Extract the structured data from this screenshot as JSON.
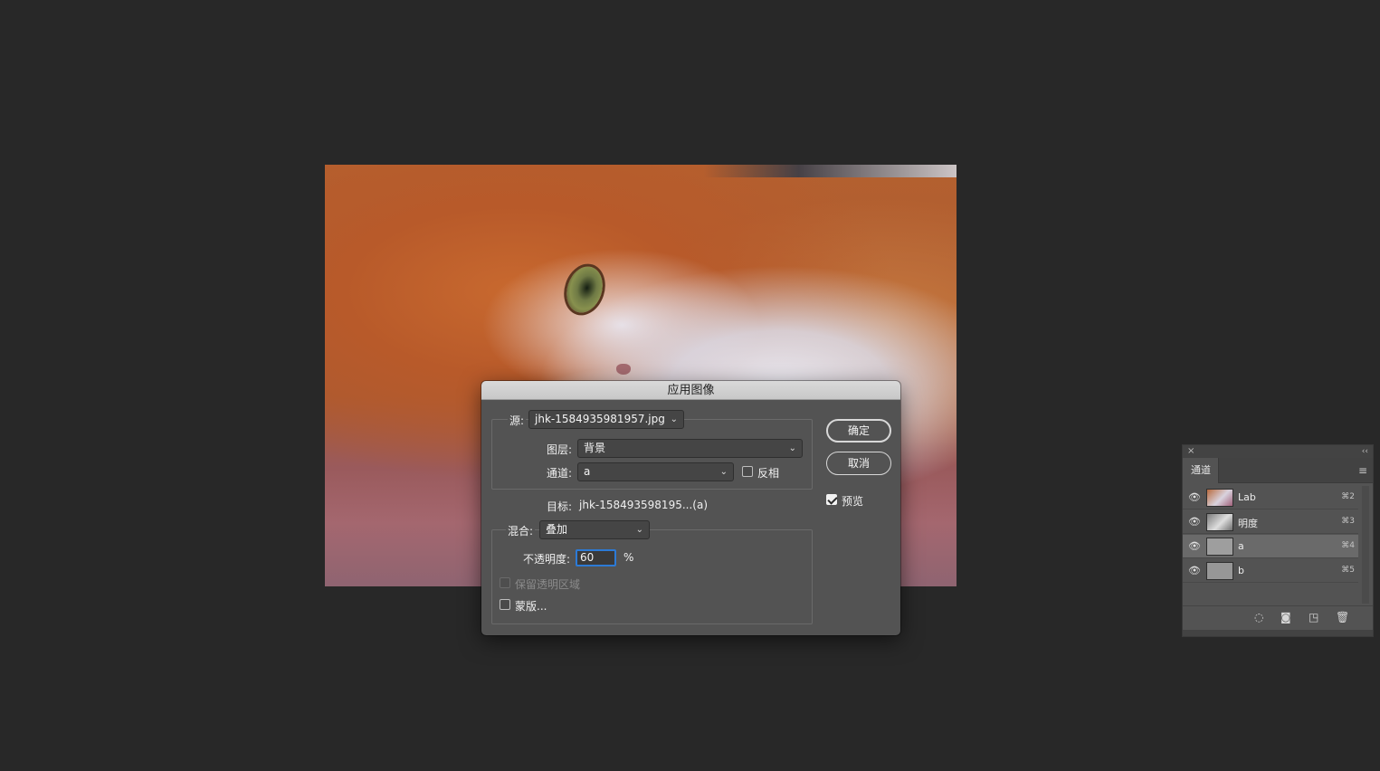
{
  "dialog": {
    "title": "应用图像",
    "source_label": "源:",
    "source_value": "jhk-1584935981957.jpg",
    "layer_label": "图层:",
    "layer_value": "背景",
    "channel_label": "通道:",
    "channel_value": "a",
    "invert_label": "反相",
    "target_label": "目标:",
    "target_value": "jhk-158493598195...(a)",
    "blend_label": "混合:",
    "blend_value": "叠加",
    "opacity_label": "不透明度:",
    "opacity_value": "60",
    "opacity_unit": "%",
    "preserve_transparency_label": "保留透明区域",
    "mask_label": "蒙版...",
    "ok_label": "确定",
    "cancel_label": "取消",
    "preview_label": "预览",
    "preview_checked": true,
    "invert_checked": false,
    "mask_checked": false
  },
  "panel": {
    "close": "×",
    "collapse": "‹‹",
    "tab": "通道",
    "menu": "≡",
    "channels": [
      {
        "name": "Lab",
        "shortcut": "⌘2",
        "selected": false
      },
      {
        "name": "明度",
        "shortcut": "⌘3",
        "selected": false
      },
      {
        "name": "a",
        "shortcut": "⌘4",
        "selected": true
      },
      {
        "name": "b",
        "shortcut": "⌘5",
        "selected": false
      }
    ],
    "footer_icons": [
      "load-selection-icon",
      "save-selection-icon",
      "new-channel-icon",
      "trash-icon"
    ]
  }
}
